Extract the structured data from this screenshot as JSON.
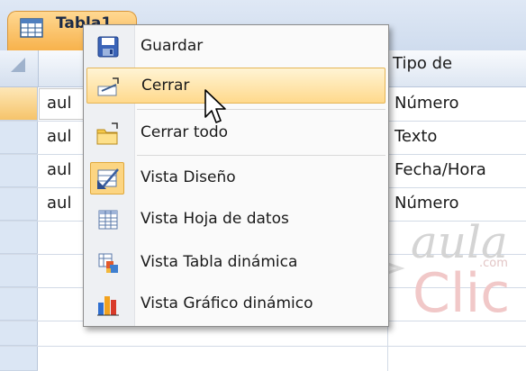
{
  "tab": {
    "label": "Tabla1"
  },
  "grid": {
    "column_header": "Tipo de",
    "rows": [
      {
        "name": "aul",
        "type": "Número"
      },
      {
        "name": "aul",
        "type": "Texto"
      },
      {
        "name": "aul",
        "type": "Fecha/Hora"
      },
      {
        "name": "aul",
        "type": "Número"
      }
    ]
  },
  "context_menu": {
    "items": [
      {
        "label": "Guardar",
        "icon": "save-icon"
      },
      {
        "label": "Cerrar",
        "icon": "close-window-icon"
      },
      {
        "label": "Cerrar todo",
        "icon": "close-all-icon"
      },
      {
        "label": "Vista Diseño",
        "icon": "design-view-icon"
      },
      {
        "label": "Vista Hoja de datos",
        "icon": "datasheet-view-icon"
      },
      {
        "label": "Vista Tabla dinámica",
        "icon": "pivot-table-icon"
      },
      {
        "label": "Vista Gráfico dinámico",
        "icon": "pivot-chart-icon"
      }
    ],
    "highlighted_item": "Cerrar"
  },
  "watermark": {
    "line1": "aula",
    "line2": "Clic",
    "small": ".com"
  }
}
